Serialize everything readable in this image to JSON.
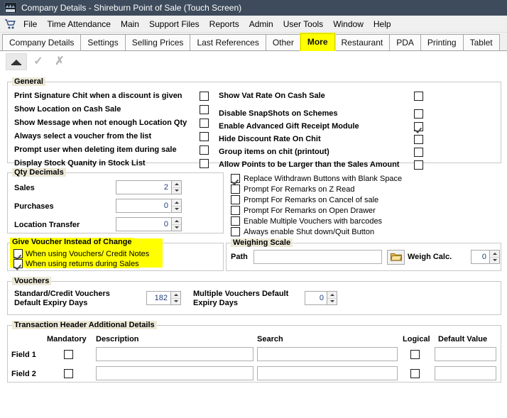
{
  "window": {
    "title": "Company Details - Shireburn Point of Sale (Touch Screen)",
    "app_icon": "pos-app-icon"
  },
  "menubar": {
    "icon": "shopping-cart-icon",
    "items": [
      "File",
      "Time Attendance",
      "Main",
      "Support Files",
      "Reports",
      "Admin",
      "User Tools",
      "Window",
      "Help"
    ]
  },
  "tabs": {
    "items": [
      {
        "label": "Company Details",
        "selected": false,
        "highlighted": false
      },
      {
        "label": "Settings",
        "selected": false,
        "highlighted": false
      },
      {
        "label": "Selling Prices",
        "selected": false,
        "highlighted": false
      },
      {
        "label": "Last References",
        "selected": false,
        "highlighted": false
      },
      {
        "label": "Other",
        "selected": false,
        "highlighted": false
      },
      {
        "label": "More",
        "selected": true,
        "highlighted": true
      },
      {
        "label": "Restaurant",
        "selected": false,
        "highlighted": false
      },
      {
        "label": "PDA",
        "selected": false,
        "highlighted": false
      },
      {
        "label": "Printing",
        "selected": false,
        "highlighted": false
      },
      {
        "label": "Tablet",
        "selected": false,
        "highlighted": false
      }
    ]
  },
  "toolbar": {
    "buttons": [
      {
        "name": "close-panel-button",
        "icon": "triangle-up-icon",
        "enabled": true
      },
      {
        "name": "confirm-button",
        "icon": "check-icon",
        "enabled": false
      },
      {
        "name": "cancel-button",
        "icon": "x-icon",
        "enabled": false
      }
    ]
  },
  "general": {
    "legend": "General",
    "left_options": [
      {
        "label": "Print Signature Chit when a discount is given",
        "checked": false
      },
      {
        "label": "Show Location on Cash Sale",
        "checked": false
      },
      {
        "label": "Show Message when not enough Location Qty",
        "checked": false
      },
      {
        "label": "Always select a voucher from the list",
        "checked": false
      },
      {
        "label": "Prompt user when deleting item during sale",
        "checked": false
      },
      {
        "label": "Display Stock Quanity in Stock List",
        "checked": false
      }
    ],
    "right_options": [
      {
        "label": "Show Vat Rate On Cash Sale",
        "checked": false
      },
      {
        "label": "Disable SnapShots on Schemes",
        "checked": false
      },
      {
        "label": "Enable Advanced Gift Receipt Module",
        "checked": true
      },
      {
        "label": "Hide Discount Rate On Chit",
        "checked": false
      },
      {
        "label": "Group items on chit (printout)",
        "checked": false
      },
      {
        "label": "Allow Points to be Larger than the Sales Amount",
        "checked": false
      }
    ]
  },
  "qty_decimals": {
    "legend": "Qty Decimals",
    "fields": [
      {
        "label": "Sales",
        "value": "2"
      },
      {
        "label": "Purchases",
        "value": "0"
      },
      {
        "label": "Location Transfer",
        "value": "0"
      }
    ]
  },
  "misc_options": [
    {
      "label": "Replace Withdrawn Buttons with Blank Space",
      "checked": true
    },
    {
      "label": "Prompt For Remarks on Z Read",
      "checked": false
    },
    {
      "label": "Prompt For Remarks on Cancel of sale",
      "checked": false
    },
    {
      "label": "Prompt For Remarks on Open Drawer",
      "checked": false
    },
    {
      "label": "Enable Multiple Vouchers with barcodes",
      "checked": false
    },
    {
      "label": "Always enable Shut down/Quit Button",
      "checked": false
    }
  ],
  "give_voucher": {
    "legend": "Give Voucher Instead of Change",
    "options": [
      {
        "label": "When using Vouchers/ Credit Notes",
        "checked": true
      },
      {
        "label": "When using returns during Sales",
        "checked": true
      }
    ]
  },
  "weighing_scale": {
    "legend": "Weighing Scale",
    "path_label": "Path",
    "path_value": "",
    "browse_icon": "folder-open-icon",
    "weigh_calc_label": "Weigh Calc.",
    "weigh_calc_value": "0"
  },
  "vouchers": {
    "legend": "Vouchers",
    "standard_label_line1": "Standard/Credit Vouchers",
    "standard_label_line2": "Default Expiry Days",
    "standard_value": "182",
    "multiple_label_line1": "Multiple Vouchers Default",
    "multiple_label_line2": "Expiry Days",
    "multiple_value": "0"
  },
  "transaction_header": {
    "legend": "Transaction Header Additional Details",
    "columns": {
      "mandatory": "Mandatory",
      "description": "Description",
      "search": "Search",
      "logical": "Logical",
      "default_value": "Default Value"
    },
    "rows": [
      {
        "label": "Field 1",
        "mandatory": false,
        "description": "",
        "search": "",
        "logical": false,
        "default_value": ""
      },
      {
        "label": "Field 2",
        "mandatory": false,
        "description": "",
        "search": "",
        "logical": false,
        "default_value": ""
      }
    ]
  },
  "colors": {
    "titlebar": "#3d4b5c",
    "highlight": "#ffff00",
    "legend_bg": "#ece9d8",
    "border": "#c8c8c8"
  }
}
